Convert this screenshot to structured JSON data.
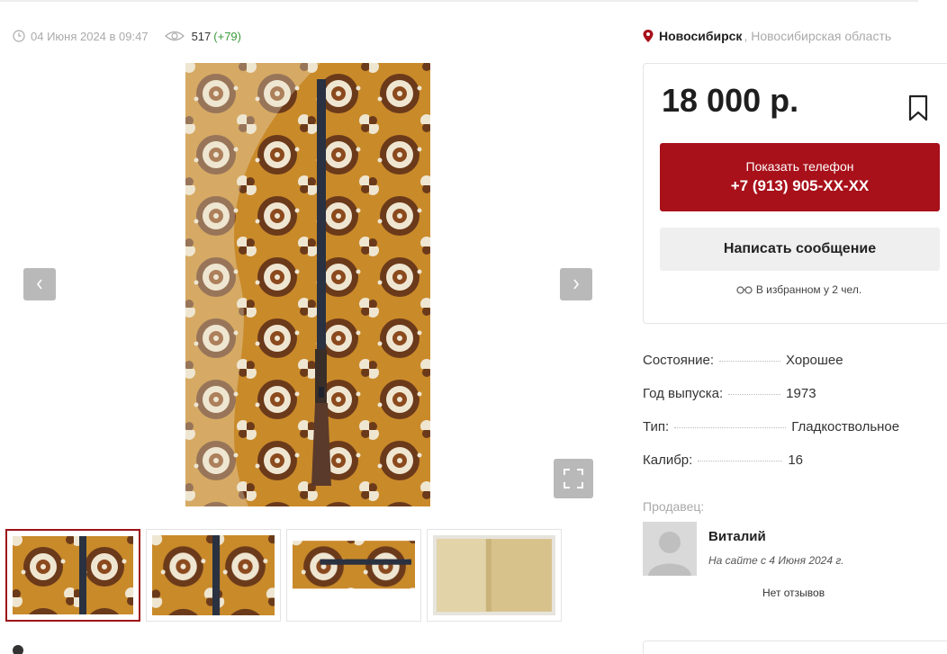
{
  "listing": {
    "date": "04 Июня 2024 в 09:47",
    "views": "517",
    "views_delta": "(+79)"
  },
  "location": {
    "city": "Новосибирск",
    "region": ", Новосибирская область"
  },
  "price_card": {
    "price": "18 000 р.",
    "phone_label": "Показать телефон",
    "phone_number": "+7 (913) 905-XX-XX",
    "message_button": "Написать сообщение",
    "favorites_text": "В избранном у 2 чел."
  },
  "specs": [
    {
      "key": "Состояние:",
      "value": "Хорошее"
    },
    {
      "key": "Год выпуска:",
      "value": "1973"
    },
    {
      "key": "Тип:",
      "value": "Гладкоствольное"
    },
    {
      "key": "Калибр:",
      "value": "16"
    }
  ],
  "seller": {
    "label": "Продавец:",
    "name": "Виталий",
    "since": "На сайте с 4 Июня 2024 г.",
    "reviews": "Нет отзывов"
  },
  "gallery": {
    "prev_icon": "chevron-left-icon",
    "next_icon": "chevron-right-icon",
    "fullscreen_icon": "expand-icon",
    "thumbnail_count": 4,
    "active_thumbnail": 1
  },
  "colors": {
    "accent": "#a8101a",
    "carpet_orange": "#c98a2a",
    "carpet_brown": "#6b3a1a",
    "carpet_cream": "#efe6d2",
    "views_delta": "#3a9a3a"
  }
}
